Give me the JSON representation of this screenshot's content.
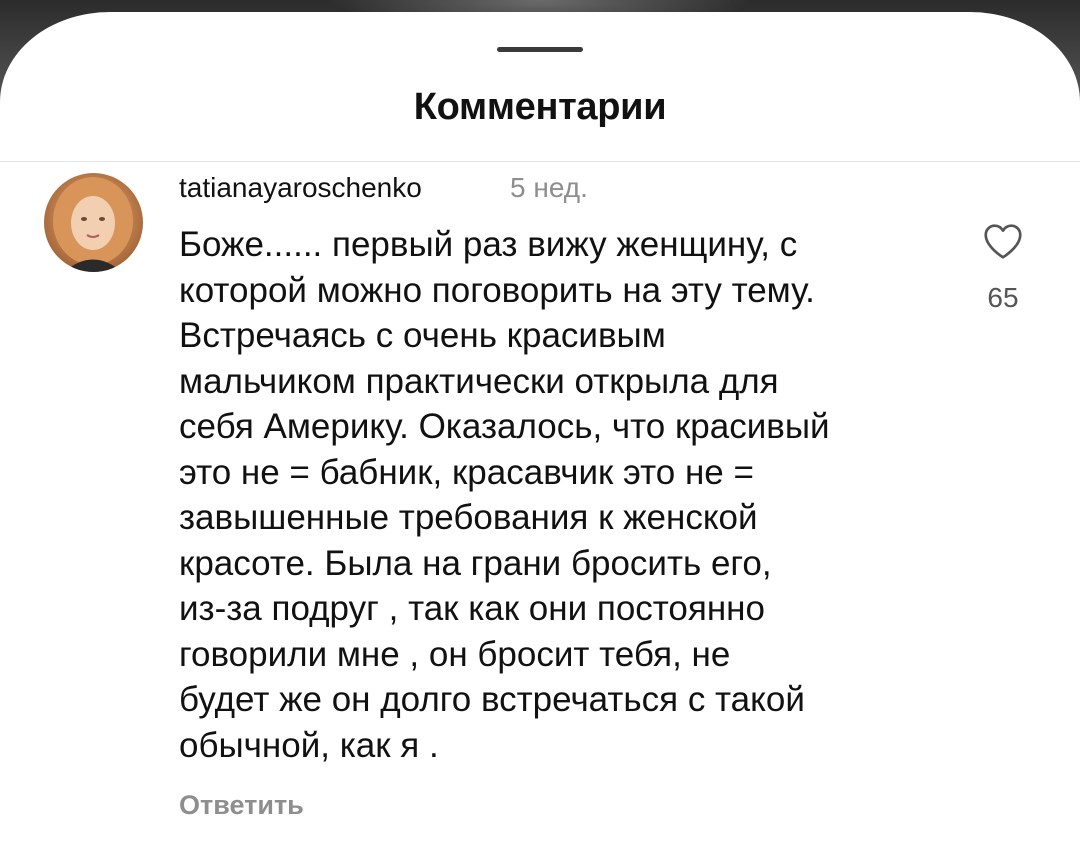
{
  "sheet": {
    "title": "Комментарии"
  },
  "comment": {
    "username": "tatianayaroschenko",
    "timestamp": "5 нед.",
    "text": "Боже...... первый раз вижу женщину,  с\nкоторой можно поговорить на эту тему.\nВстречаясь с очень красивым\nмальчиком практически открыла для\nсебя Америку. Оказалось, что красивый\nэто не = бабник, красавчик это не =\nзавышенные требования к женской\nкрасоте.  Была на грани бросить его,\nиз-за  подруг ,  так как они постоянно\nговорили мне ,  он бросит тебя,  не\nбудет же он долго встречаться с такой\nобычной, как я .",
    "like_count": "65",
    "reply_label": "Ответить",
    "avatar_icon": "user-avatar-icon",
    "like_icon": "heart-outline-icon"
  },
  "colors": {
    "text": "#111111",
    "muted": "#8e8e8e",
    "sheet_bg": "#ffffff"
  }
}
